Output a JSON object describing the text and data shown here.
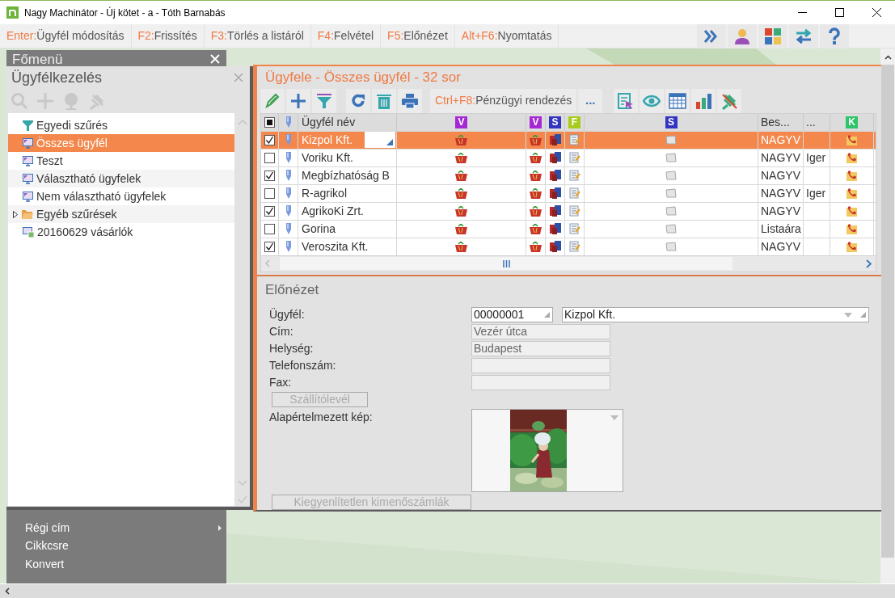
{
  "window": {
    "title": "Nagy Machinátor - Új kötet - a - Tóth Barnabás"
  },
  "shortcuts": [
    {
      "key": "Enter:",
      "label": "Ügyfél módosítás"
    },
    {
      "key": "F2:",
      "label": "Frissítés"
    },
    {
      "key": "F3:",
      "label": "Törlés a listáról"
    },
    {
      "key": "F4:",
      "label": "Felvétel"
    },
    {
      "key": "F5:",
      "label": "Előnézet"
    },
    {
      "key": "Alt+F6:",
      "label": "Nyomtatás"
    }
  ],
  "main_menu": {
    "title": "Főmenü",
    "items": [
      {
        "label": "Régi cím",
        "kind": "submenu"
      },
      {
        "label": "Cikkcsre",
        "kind": "command"
      },
      {
        "label": "Konvert",
        "kind": "command"
      }
    ]
  },
  "filter_panel": {
    "title": "Ügyfélkezelés",
    "items": [
      {
        "label": "Egyedi szűrés",
        "kind": "filter",
        "selected": false
      },
      {
        "label": "Összes ügyfél",
        "kind": "view",
        "selected": true
      },
      {
        "label": "Teszt",
        "kind": "view",
        "selected": false
      },
      {
        "label": "Választható ügyfelek",
        "kind": "view",
        "selected": false
      },
      {
        "label": "Nem választható ügyfelek",
        "kind": "view",
        "selected": false
      },
      {
        "label": "Egyéb szűrések",
        "kind": "folder",
        "expanded": false,
        "selected": false
      },
      {
        "label": "20160629 vásárlók",
        "kind": "saved",
        "selected": false
      }
    ]
  },
  "grid_panel": {
    "title": "Ügyfele - Összes ügyfél - 32 sor",
    "toolbar_shortcut": {
      "key": "Ctrl+F8:",
      "label": "Pénzügyi rendezés"
    },
    "more_button": "...",
    "select_all": {
      "indeterminate": true
    },
    "columns": [
      {
        "kind": "check"
      },
      {
        "kind": "pin"
      },
      {
        "kind": "text",
        "label": "Ügyfél név"
      },
      {
        "kind": "badge",
        "label": "V",
        "color": "#a428d4"
      },
      {
        "kind": "badge",
        "label": "V",
        "color": "#a428d4"
      },
      {
        "kind": "badge",
        "label": "S",
        "color": "#3434c4"
      },
      {
        "kind": "badge",
        "label": "F",
        "color": "#a8cc1c"
      },
      {
        "kind": "badge",
        "label": "S",
        "color": "#3434c4"
      },
      {
        "kind": "text",
        "label": "Bes..."
      },
      {
        "kind": "text",
        "label": "..."
      },
      {
        "kind": "badge",
        "label": "K",
        "color": "#2ec46a"
      }
    ],
    "rows": [
      {
        "checked": true,
        "selected": true,
        "name": "Kizpol Kft.",
        "column_9": "NAGYV"
      },
      {
        "checked": false,
        "selected": false,
        "name": "Voriku Kft.",
        "column_9": "NAGYV",
        "column_10": "Iger"
      },
      {
        "checked": true,
        "selected": false,
        "name": "Megbízhatóság B",
        "column_9": "NAGYV"
      },
      {
        "checked": false,
        "selected": false,
        "name": "R-agrikol",
        "column_9": "NAGYV",
        "column_10": "Iger"
      },
      {
        "checked": true,
        "selected": false,
        "name": "AgrikoKi Zrt.",
        "column_9": "NAGYV"
      },
      {
        "checked": false,
        "selected": false,
        "name": "Gorina",
        "column_9": "Listaára"
      },
      {
        "checked": true,
        "selected": false,
        "name": "Veroszita Kft.",
        "column_9": "NAGYV"
      }
    ]
  },
  "preview": {
    "title": "Előnézet",
    "fields": [
      {
        "label": "Ügyfél:",
        "kind": "lookup",
        "code": "00000001",
        "value": "Kizpol Kft."
      },
      {
        "label": "Cím:",
        "kind": "text",
        "value": "Vezér útca"
      },
      {
        "label": "Helység:",
        "kind": "text",
        "value": "Budapest"
      },
      {
        "label": "Telefonszám:",
        "kind": "text"
      },
      {
        "label": "Fax:",
        "kind": "text"
      }
    ],
    "delivery_button": {
      "label": "Szállítólevél",
      "disabled": true
    },
    "image_label": "Alapértelmezett kép:",
    "invoices_button": {
      "label": "Kiegyenlítetlen kimenőszámlák",
      "disabled": true
    }
  }
}
